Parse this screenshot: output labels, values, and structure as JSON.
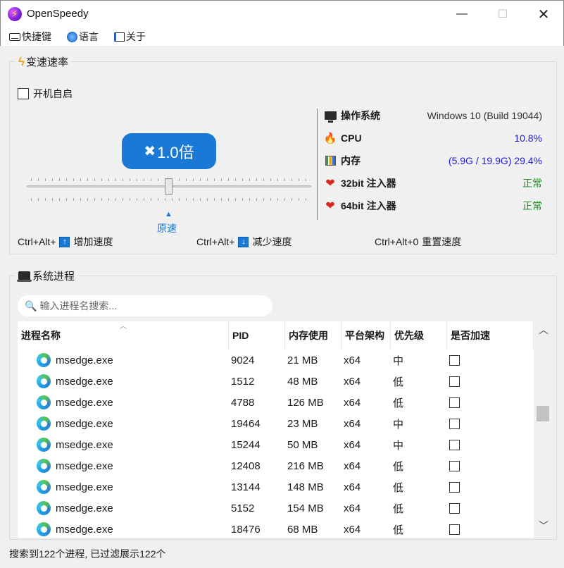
{
  "window": {
    "title": "OpenSpeedy",
    "minimize": "—",
    "maximize": "☐",
    "close": "✕"
  },
  "menu": [
    {
      "label": "快捷键",
      "icon": "keyboard-icon"
    },
    {
      "label": "语言",
      "icon": "globe-icon"
    },
    {
      "label": "关于",
      "icon": "book-icon"
    }
  ],
  "speed_panel": {
    "title": "变速速率",
    "autostart_label": "开机自启",
    "autostart_checked": false,
    "speed_display": "1.0倍",
    "speed_prefix": "✖",
    "slider_mark_label": "原速",
    "slider_position": 0.5,
    "hotkeys": [
      {
        "prefix": "Ctrl+Alt+",
        "key": "↑",
        "label": "增加速度"
      },
      {
        "prefix": "Ctrl+Alt+",
        "key": "↓",
        "label": "减少速度"
      },
      {
        "prefix": "Ctrl+Alt+0",
        "key": "",
        "label": "重置速度"
      }
    ]
  },
  "system_info": [
    {
      "label": "操作系统",
      "value": "Windows 10 (Build 19044)",
      "icon": "monitor-icon",
      "color": "#333333"
    },
    {
      "label": "CPU",
      "value": "10.8%",
      "icon": "flame-icon",
      "color": "#1a1adc"
    },
    {
      "label": "内存",
      "value": "(5.9G / 19.9G) 29.4%",
      "icon": "memory-icon",
      "color": "#1a1adc"
    },
    {
      "label": "32bit 注入器",
      "value": "正常",
      "icon": "heart-icon",
      "color": "#1a8f1a"
    },
    {
      "label": "64bit 注入器",
      "value": "正常",
      "icon": "heart-icon",
      "color": "#1a8f1a"
    }
  ],
  "process_panel": {
    "title": "系统进程",
    "search_placeholder": "输入进程名搜索...",
    "columns": [
      "进程名称",
      "PID",
      "内存使用",
      "平台架构",
      "优先级",
      "是否加速"
    ],
    "rows": [
      {
        "name": "msedge.exe",
        "pid": "9024",
        "mem": "21 MB",
        "arch": "x64",
        "priority": "中",
        "accelerated": false
      },
      {
        "name": "msedge.exe",
        "pid": "1512",
        "mem": "48 MB",
        "arch": "x64",
        "priority": "低",
        "accelerated": false
      },
      {
        "name": "msedge.exe",
        "pid": "4788",
        "mem": "126 MB",
        "arch": "x64",
        "priority": "低",
        "accelerated": false
      },
      {
        "name": "msedge.exe",
        "pid": "19464",
        "mem": "23 MB",
        "arch": "x64",
        "priority": "中",
        "accelerated": false
      },
      {
        "name": "msedge.exe",
        "pid": "15244",
        "mem": "50 MB",
        "arch": "x64",
        "priority": "中",
        "accelerated": false
      },
      {
        "name": "msedge.exe",
        "pid": "12408",
        "mem": "216 MB",
        "arch": "x64",
        "priority": "低",
        "accelerated": false
      },
      {
        "name": "msedge.exe",
        "pid": "13144",
        "mem": "148 MB",
        "arch": "x64",
        "priority": "低",
        "accelerated": false
      },
      {
        "name": "msedge.exe",
        "pid": "5152",
        "mem": "154 MB",
        "arch": "x64",
        "priority": "低",
        "accelerated": false
      },
      {
        "name": "msedge.exe",
        "pid": "18476",
        "mem": "68 MB",
        "arch": "x64",
        "priority": "低",
        "accelerated": false
      }
    ]
  },
  "status": "搜索到122个进程, 已过滤展示122个"
}
